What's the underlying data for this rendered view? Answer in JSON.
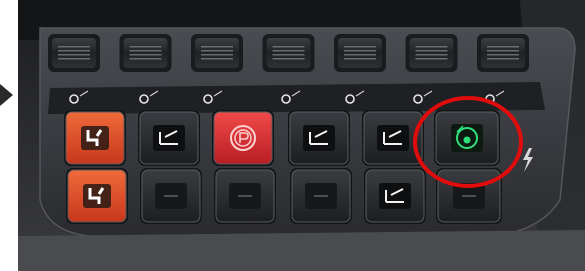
{
  "scene": {
    "subject": "switch-panel",
    "accent_colors": {
      "active_red": "#d8391f",
      "park_brake_red": "#c4222a",
      "indicator_green": "#2fe07a",
      "highlight_circle": "#e10c0c",
      "panel": "#2b2d31"
    },
    "top_row_keys": 7,
    "legend_icons": [
      "gear-cog-icon",
      "steering-wheel-icon",
      "key-icon",
      "hitch-icon",
      "ground-drive-icon",
      "speed-step-icon",
      "return-icon"
    ],
    "button_rows": [
      [
        {
          "icon": "differential-lock-up-icon",
          "state": "active-orange"
        },
        {
          "icon": "four-wheel-drive-icon",
          "state": "lit"
        },
        {
          "icon": "parking-brake-icon",
          "state": "active-red"
        },
        {
          "icon": "implement-raise-icon",
          "state": "lit"
        },
        {
          "icon": "suspension-icon",
          "state": "lit"
        },
        {
          "icon": "auto-steer-icon",
          "state": "active-green",
          "highlighted": true
        }
      ],
      [
        {
          "icon": "differential-lock-down-icon",
          "state": "active-orange"
        },
        {
          "icon": "lock-icon",
          "state": "dim"
        },
        {
          "icon": "hitch-arm-icon",
          "state": "dim"
        },
        {
          "icon": "terrain-icon",
          "state": "dim"
        },
        {
          "icon": "front-suspension-icon",
          "state": "lit"
        },
        {
          "icon": "blank-icon",
          "state": "dim"
        }
      ]
    ],
    "side_symbol": "lightning-icon"
  }
}
